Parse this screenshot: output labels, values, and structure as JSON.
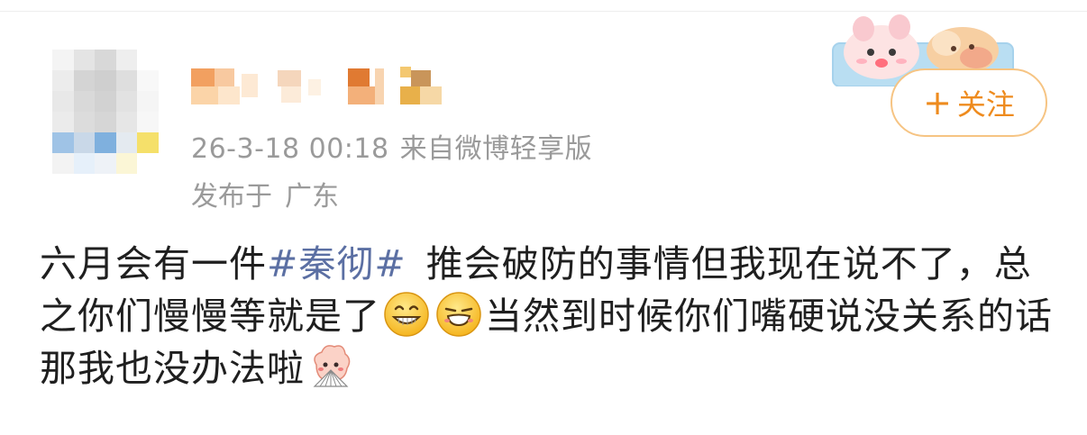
{
  "post": {
    "timestamp": "26-3-18 00:18",
    "source": "来自微博轻享版",
    "location_prefix": "发布于",
    "location": "广东",
    "text": {
      "part1": "六月会有一件",
      "topic": "#秦彻#",
      "part2": "推会破防的事情但我现在说不了，总之你们慢慢等就是了",
      "part3": "当然到时候你们嘴硬说没关系的话那我也没办法啦"
    },
    "emojis": [
      "grin-emoji",
      "smirk-emoji",
      "shy-fan-emoji"
    ]
  },
  "follow": {
    "plus": "+",
    "label": "关注"
  },
  "colors": {
    "meta": "#9a9a9a",
    "topic": "#5b6fa3",
    "follow_text": "#ee8b1e",
    "follow_border": "#f6c483",
    "body_text": "#1f1f1f"
  }
}
